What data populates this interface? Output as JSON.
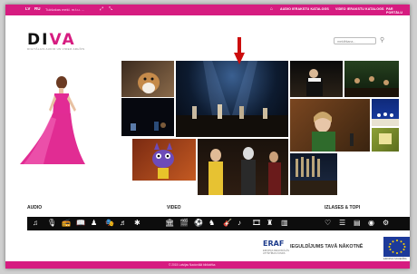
{
  "topbar": {
    "lang_lv": "LV",
    "lang_ru": "RU",
    "tagline": "Tukšakas mekl. m.t.u. ...",
    "nav_audio": "AUDIO IERAKSTU KATALOGS",
    "nav_video": "VIDEO IERAKSTU KATALOGS",
    "nav_portal": "PAR PORTĀLU"
  },
  "logo": {
    "text_di": "DI",
    "text_va": "VA",
    "subtitle": "DIGITĀLAIS AUDIO UN VIDEO ARHĪVS"
  },
  "search": {
    "placeholder": "meklēšana..."
  },
  "sections": {
    "audio": "AUDIO",
    "video": "VIDEO",
    "playlists": "IZLASES & TOPI"
  },
  "icons": {
    "audio": [
      "note-icon",
      "microphone-icon",
      "radio-icon",
      "book-icon",
      "piano-icon",
      "theater-icon",
      "dance-icon",
      "more-icon"
    ],
    "video": [
      "museum-icon",
      "film-icon",
      "sport-icon",
      "person-icon",
      "instrument-icon",
      "music-icon",
      "camera-icon",
      "choir-icon",
      "stage-icon"
    ],
    "playlists": [
      "favorites-icon",
      "list-icon",
      "playlist-icon",
      "eye-icon",
      "top-icon"
    ]
  },
  "footer": {
    "eraf": "ERAF",
    "eraf_sub": "EIROPAS REĢIONĀLĀS ATTĪSTĪBAS FONDS",
    "slogan": "IEGULDĪJUMS TAVĀ NĀKOTNĒ",
    "eu_caption": "EIROPAS SAVIENĪBA",
    "copyright": "© 2015 Latvijas Nacionālā bibliotēka"
  },
  "colors": {
    "brand": "#d61c80",
    "iconbar": "#0d0d0d"
  }
}
